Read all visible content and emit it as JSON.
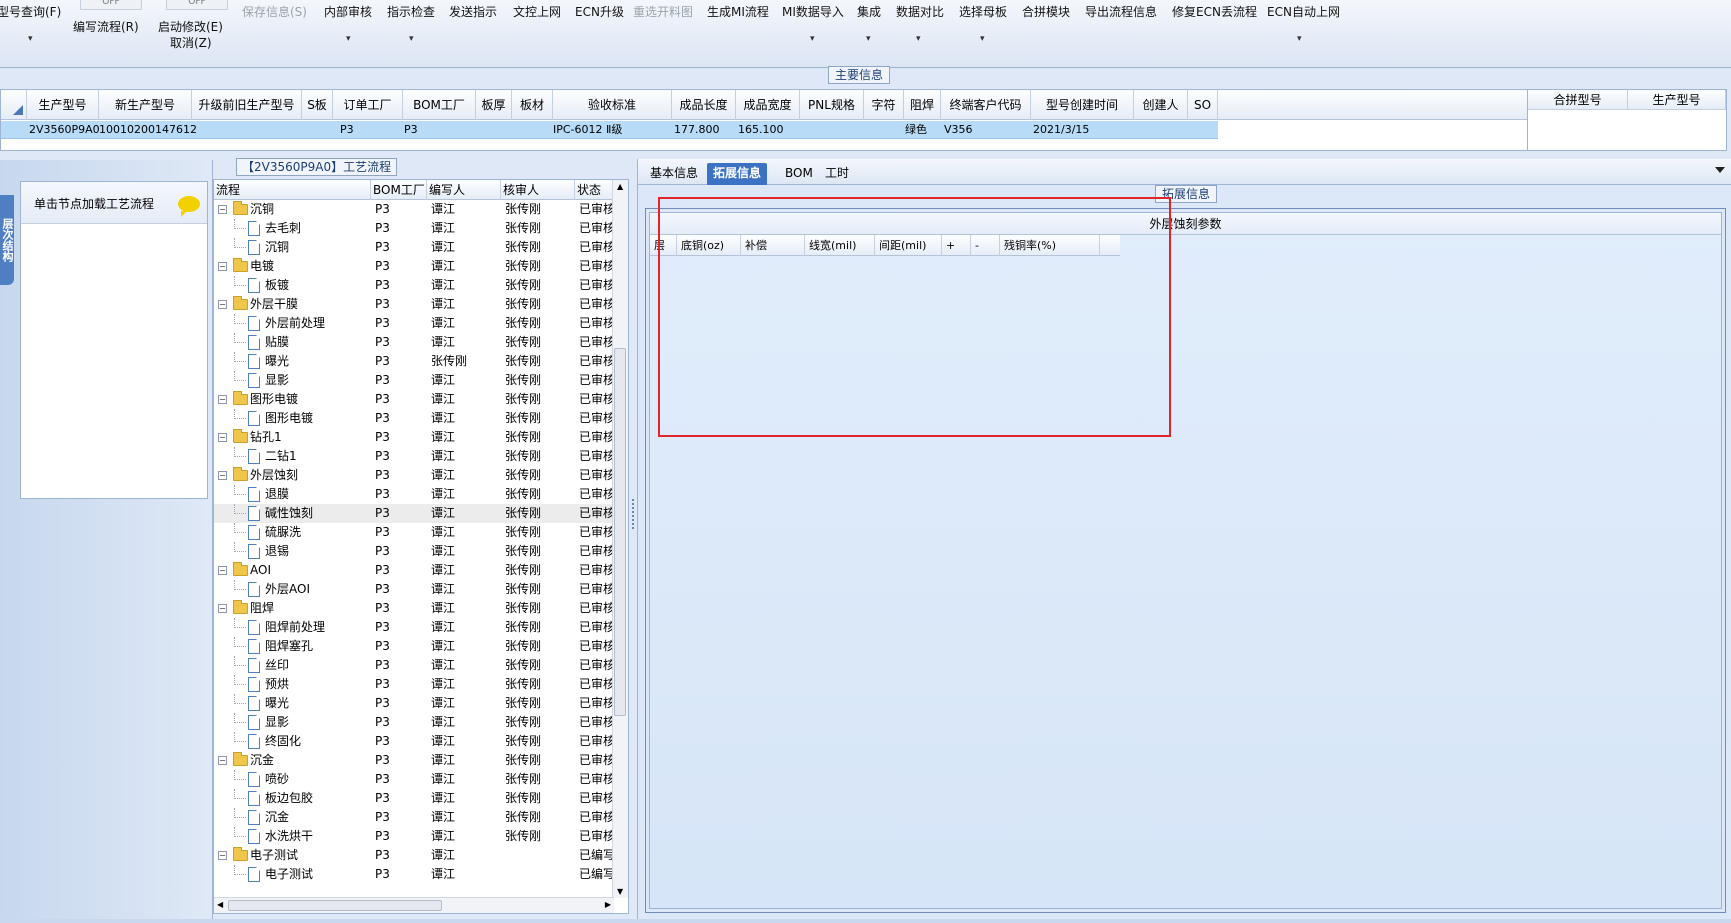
{
  "ribbon": {
    "items": [
      {
        "label": "型号查询(F)",
        "x": 0,
        "disabled": false,
        "dropdown": true
      },
      {
        "label": "编写流程(R)",
        "disabled": false
      },
      {
        "label": "启动修改(E)",
        "sub": "取消(Z)",
        "disabled": false
      },
      {
        "label": "保存信息(S)",
        "disabled": true
      },
      {
        "label": "内部审核",
        "disabled": false,
        "dropdown": true
      },
      {
        "label": "指示检查",
        "disabled": false,
        "dropdown": true
      },
      {
        "label": "发送指示",
        "disabled": false
      },
      {
        "label": "文控上网",
        "disabled": false
      },
      {
        "label": "ECN升级",
        "disabled": false
      },
      {
        "label": "重选开料图",
        "disabled": true
      },
      {
        "label": "生成MI流程",
        "disabled": false
      },
      {
        "label": "MI数据导入",
        "disabled": false,
        "dropdown": true
      },
      {
        "label": "集成",
        "disabled": false,
        "dropdown": true
      },
      {
        "label": "数据对比",
        "disabled": false,
        "dropdown": true
      },
      {
        "label": "选择母板",
        "disabled": false,
        "dropdown": true
      },
      {
        "label": "合拼模块",
        "disabled": false
      },
      {
        "label": "导出流程信息",
        "disabled": false
      },
      {
        "label": "修复ECN丢流程",
        "disabled": false
      },
      {
        "label": "ECN自动上网",
        "disabled": false,
        "dropdown": true
      }
    ],
    "toggle_text": "OFF"
  },
  "main_info_label": "主要信息",
  "top_grid": {
    "columns": [
      "生产型号",
      "新生产型号",
      "升级前旧生产型号",
      "S板",
      "订单工厂",
      "BOM工厂",
      "板厚",
      "板材",
      "验收标准",
      "成品长度",
      "成品宽度",
      "PNL规格",
      "字符",
      "阻焊",
      "终端客户代码",
      "型号创建时间",
      "创建人",
      "SO"
    ],
    "row": [
      "2V3560P9A0",
      "10010200147612",
      "",
      "",
      "P3",
      "P3",
      "",
      "",
      "IPC-6012 Ⅱ级",
      "177.800",
      "165.100",
      "",
      "",
      "绿色",
      "V356",
      "2021/3/15",
      "",
      ""
    ]
  },
  "merge_grid": {
    "columns": [
      "合拼型号",
      "生产型号"
    ]
  },
  "left_panel": {
    "vertical_tab": "层次结构",
    "load_hint": "单击节点加载工艺流程"
  },
  "process_panel": {
    "title": "【2V3560P9A0】工艺流程",
    "columns": [
      "流程",
      "BOM工厂",
      "编写人",
      "核审人",
      "状态"
    ],
    "rows": [
      {
        "level": 0,
        "type": "folder",
        "name": "沉铜",
        "bom": "P3",
        "writer": "谭江",
        "reviewer": "张传刚",
        "status": "已审核"
      },
      {
        "level": 1,
        "type": "doc",
        "name": "去毛刺",
        "bom": "P3",
        "writer": "谭江",
        "reviewer": "张传刚",
        "status": "已审核"
      },
      {
        "level": 1,
        "type": "doc",
        "name": "沉铜",
        "bom": "P3",
        "writer": "谭江",
        "reviewer": "张传刚",
        "status": "已审核"
      },
      {
        "level": 0,
        "type": "folder",
        "name": "电镀",
        "bom": "P3",
        "writer": "谭江",
        "reviewer": "张传刚",
        "status": "已审核"
      },
      {
        "level": 1,
        "type": "doc",
        "name": "板镀",
        "bom": "P3",
        "writer": "谭江",
        "reviewer": "张传刚",
        "status": "已审核"
      },
      {
        "level": 0,
        "type": "folder",
        "name": "外层干膜",
        "bom": "P3",
        "writer": "谭江",
        "reviewer": "张传刚",
        "status": "已审核"
      },
      {
        "level": 1,
        "type": "doc",
        "name": "外层前处理",
        "bom": "P3",
        "writer": "谭江",
        "reviewer": "张传刚",
        "status": "已审核"
      },
      {
        "level": 1,
        "type": "doc",
        "name": "贴膜",
        "bom": "P3",
        "writer": "谭江",
        "reviewer": "张传刚",
        "status": "已审核"
      },
      {
        "level": 1,
        "type": "doc",
        "name": "曝光",
        "bom": "P3",
        "writer": "张传刚",
        "reviewer": "张传刚",
        "status": "已审核"
      },
      {
        "level": 1,
        "type": "doc",
        "name": "显影",
        "bom": "P3",
        "writer": "谭江",
        "reviewer": "张传刚",
        "status": "已审核"
      },
      {
        "level": 0,
        "type": "folder",
        "name": "图形电镀",
        "bom": "P3",
        "writer": "谭江",
        "reviewer": "张传刚",
        "status": "已审核"
      },
      {
        "level": 1,
        "type": "doc",
        "name": "图形电镀",
        "bom": "P3",
        "writer": "谭江",
        "reviewer": "张传刚",
        "status": "已审核"
      },
      {
        "level": 0,
        "type": "folder",
        "name": "钻孔1",
        "bom": "P3",
        "writer": "谭江",
        "reviewer": "张传刚",
        "status": "已审核"
      },
      {
        "level": 1,
        "type": "doc",
        "name": "二钻1",
        "bom": "P3",
        "writer": "谭江",
        "reviewer": "张传刚",
        "status": "已审核"
      },
      {
        "level": 0,
        "type": "folder",
        "name": "外层蚀刻",
        "bom": "P3",
        "writer": "谭江",
        "reviewer": "张传刚",
        "status": "已审核"
      },
      {
        "level": 1,
        "type": "doc",
        "name": "退膜",
        "bom": "P3",
        "writer": "谭江",
        "reviewer": "张传刚",
        "status": "已审核"
      },
      {
        "level": 1,
        "type": "doc",
        "name": "碱性蚀刻",
        "bom": "P3",
        "writer": "谭江",
        "reviewer": "张传刚",
        "status": "已审核",
        "selected": true
      },
      {
        "level": 1,
        "type": "doc",
        "name": "硫脲洗",
        "bom": "P3",
        "writer": "谭江",
        "reviewer": "张传刚",
        "status": "已审核"
      },
      {
        "level": 1,
        "type": "doc",
        "name": "退锡",
        "bom": "P3",
        "writer": "谭江",
        "reviewer": "张传刚",
        "status": "已审核"
      },
      {
        "level": 0,
        "type": "folder",
        "name": "AOI",
        "bom": "P3",
        "writer": "谭江",
        "reviewer": "张传刚",
        "status": "已审核"
      },
      {
        "level": 1,
        "type": "doc",
        "name": "外层AOI",
        "bom": "P3",
        "writer": "谭江",
        "reviewer": "张传刚",
        "status": "已审核"
      },
      {
        "level": 0,
        "type": "folder",
        "name": "阻焊",
        "bom": "P3",
        "writer": "谭江",
        "reviewer": "张传刚",
        "status": "已审核"
      },
      {
        "level": 1,
        "type": "doc",
        "name": "阻焊前处理",
        "bom": "P3",
        "writer": "谭江",
        "reviewer": "张传刚",
        "status": "已审核"
      },
      {
        "level": 1,
        "type": "doc",
        "name": "阻焊塞孔",
        "bom": "P3",
        "writer": "谭江",
        "reviewer": "张传刚",
        "status": "已审核"
      },
      {
        "level": 1,
        "type": "doc",
        "name": "丝印",
        "bom": "P3",
        "writer": "谭江",
        "reviewer": "张传刚",
        "status": "已审核"
      },
      {
        "level": 1,
        "type": "doc",
        "name": "预烘",
        "bom": "P3",
        "writer": "谭江",
        "reviewer": "张传刚",
        "status": "已审核"
      },
      {
        "level": 1,
        "type": "doc",
        "name": "曝光",
        "bom": "P3",
        "writer": "谭江",
        "reviewer": "张传刚",
        "status": "已审核"
      },
      {
        "level": 1,
        "type": "doc",
        "name": "显影",
        "bom": "P3",
        "writer": "谭江",
        "reviewer": "张传刚",
        "status": "已审核"
      },
      {
        "level": 1,
        "type": "doc",
        "name": "终固化",
        "bom": "P3",
        "writer": "谭江",
        "reviewer": "张传刚",
        "status": "已审核"
      },
      {
        "level": 0,
        "type": "folder",
        "name": "沉金",
        "bom": "P3",
        "writer": "谭江",
        "reviewer": "张传刚",
        "status": "已审核"
      },
      {
        "level": 1,
        "type": "doc",
        "name": "喷砂",
        "bom": "P3",
        "writer": "谭江",
        "reviewer": "张传刚",
        "status": "已审核"
      },
      {
        "level": 1,
        "type": "doc",
        "name": "板边包胶",
        "bom": "P3",
        "writer": "谭江",
        "reviewer": "张传刚",
        "status": "已审核"
      },
      {
        "level": 1,
        "type": "doc",
        "name": "沉金",
        "bom": "P3",
        "writer": "谭江",
        "reviewer": "张传刚",
        "status": "已审核"
      },
      {
        "level": 1,
        "type": "doc",
        "name": "水洗烘干",
        "bom": "P3",
        "writer": "谭江",
        "reviewer": "张传刚",
        "status": "已审核"
      },
      {
        "level": 0,
        "type": "folder",
        "name": "电子测试",
        "bom": "P3",
        "writer": "谭江",
        "reviewer": "",
        "status": "已编写"
      },
      {
        "level": 1,
        "type": "doc",
        "name": "电子测试",
        "bom": "P3",
        "writer": "谭江",
        "reviewer": "",
        "status": "已编写"
      }
    ]
  },
  "right_panel": {
    "tabs": [
      "基本信息",
      "拓展信息",
      "BOM",
      "工时"
    ],
    "active_tab": 1,
    "section_label": "拓展信息",
    "etch_title": "外层蚀刻参数",
    "etch_columns": [
      "层",
      "底铜(oz)",
      "补偿",
      "线宽(mil)",
      "间距(mil)",
      "+",
      "-",
      "残铜率(%)"
    ]
  }
}
